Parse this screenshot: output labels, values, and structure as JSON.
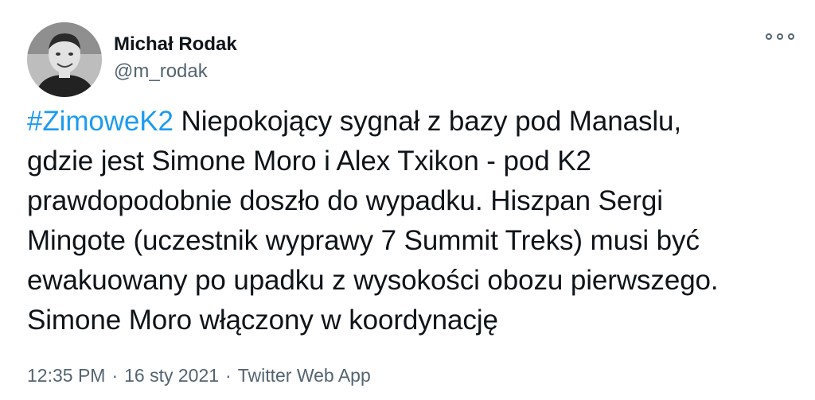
{
  "author": {
    "display_name": "Michał Rodak",
    "handle": "@m_rodak"
  },
  "icons": {
    "avatar": "profile-photo",
    "more": "more-options-icon"
  },
  "tweet": {
    "hashtag": "#ZimoweK2",
    "lines": [
      " Niepokojący sygnał z bazy pod Manaslu,",
      "gdzie jest Simone Moro i Alex Txikon - pod K2",
      "prawdopodobnie doszło do wypadku. Hiszpan Sergi",
      "Mingote (uczestnik wyprawy 7 Summit Treks) musi być",
      "ewakuowany po upadku z wysokości obozu pierwszego.",
      "Simone Moro włączony w koordynację"
    ]
  },
  "meta": {
    "time": "12:35 PM",
    "separator": "·",
    "date": "16 sty 2021",
    "source": "Twitter Web App"
  },
  "colors": {
    "link": "#1d9bf0",
    "secondary_text": "#536471",
    "primary_text": "#0f1419"
  }
}
